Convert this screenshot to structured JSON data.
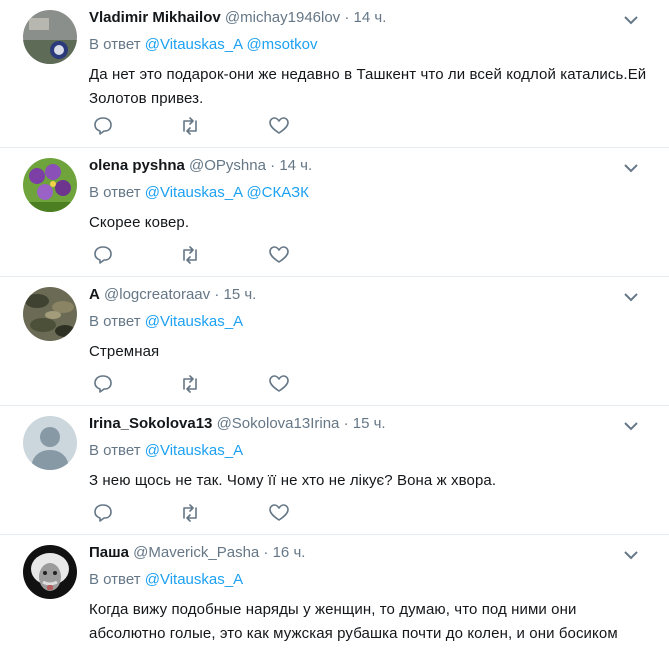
{
  "reply_prefix": "В ответ",
  "tweets": [
    {
      "name": "Vladimir Mikhailov",
      "handle": "@michay1946lov",
      "dot": "·",
      "time": "14 ч.",
      "mentions": [
        "@Vitauskas_A",
        "@msotkov"
      ],
      "text": "Да нет это подарок-они же недавно в Ташкент что ли всей кодлой катались.Ей Золотов привез.",
      "avatar": "avatar-vladimir"
    },
    {
      "name": "olena pyshna",
      "handle": "@OPyshna",
      "dot": "·",
      "time": "14 ч.",
      "mentions": [
        "@Vitauskas_A",
        "@СКАЗК"
      ],
      "text": "Скорее ковер.",
      "avatar": "avatar-olena"
    },
    {
      "name": "A",
      "handle": "@logcreatoraav",
      "dot": "·",
      "time": "15 ч.",
      "mentions": [
        "@Vitauskas_A"
      ],
      "text": "Стремная",
      "avatar": "avatar-camo"
    },
    {
      "name": "Irina_Sokolova13",
      "handle": "@Sokolova13Irina",
      "dot": "·",
      "time": "15 ч.",
      "mentions": [
        "@Vitauskas_A"
      ],
      "text": "З нею щось не так. Чому її не хто не лікує? Вона ж хвора.",
      "avatar": "avatar-default"
    },
    {
      "name": "Паша",
      "handle": "@Maverick_Pasha",
      "dot": "·",
      "time": "16 ч.",
      "mentions": [
        "@Vitauskas_A"
      ],
      "text": "Когда вижу подобные наряды у женщин, то думаю, что под ними они абсолютно голые, это как мужская рубашка почти до колен, и они босиком",
      "avatar": "avatar-einstein"
    }
  ],
  "colors": {
    "accent": "#1da1f2",
    "muted": "#657786",
    "icon": "#657786",
    "divider": "#e6ecf0"
  }
}
